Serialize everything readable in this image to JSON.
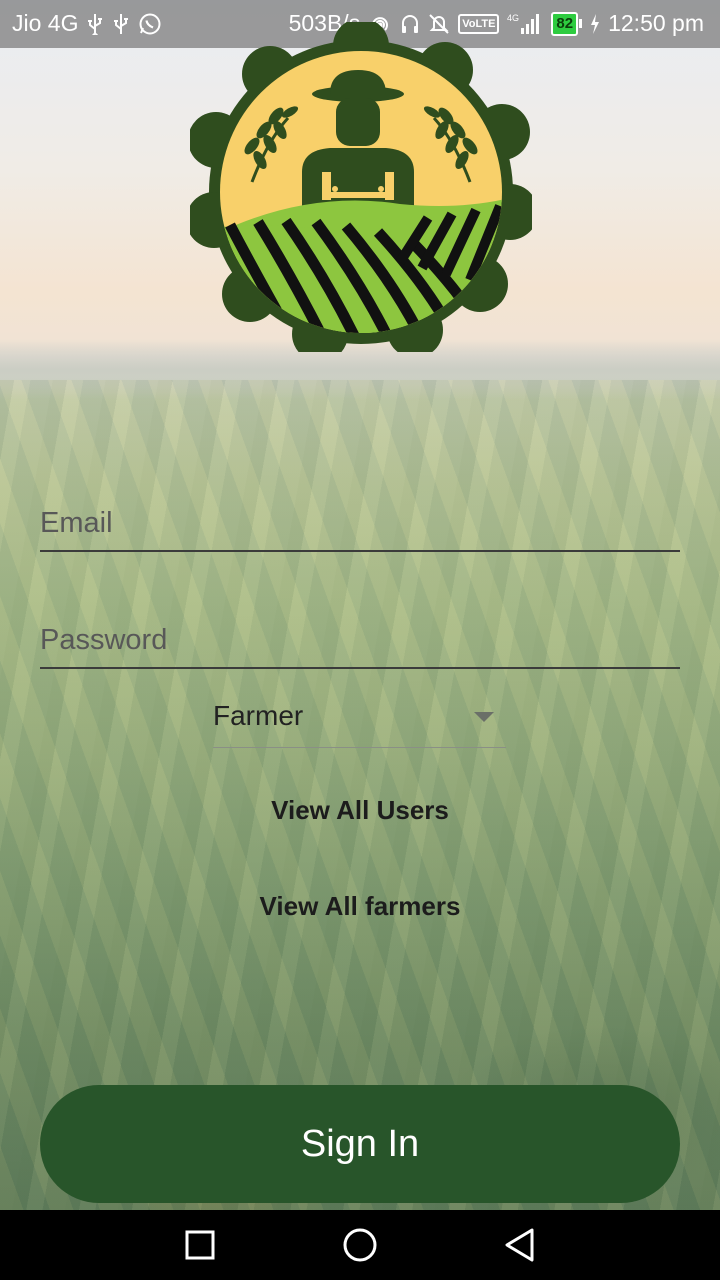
{
  "status_bar": {
    "carrier": "Jio 4G",
    "net_speed": "503B/s",
    "volte": "VoLTE",
    "network": "4G",
    "battery": "82",
    "time": "12:50 pm"
  },
  "form": {
    "email_placeholder": "Email",
    "password_placeholder": "Password",
    "role_selected": "Farmer"
  },
  "links": {
    "view_users": "View All Users",
    "view_farmers": "View All farmers"
  },
  "sign_in_label": "Sign In",
  "colors": {
    "primary": "#28552a",
    "logo_dark": "#2f4d1e",
    "logo_sun": "#f8d06a",
    "logo_field": "#8dc63f"
  },
  "icons": {
    "usb_1": "usb-icon",
    "usb_2": "usb-icon",
    "whatsapp": "whatsapp-icon",
    "hotspot": "hotspot-icon",
    "headset": "headset-icon",
    "mute": "mute-icon",
    "signal": "signal-icon",
    "charging": "charging-icon",
    "recents": "recents-icon",
    "home": "home-icon",
    "back": "back-icon"
  }
}
